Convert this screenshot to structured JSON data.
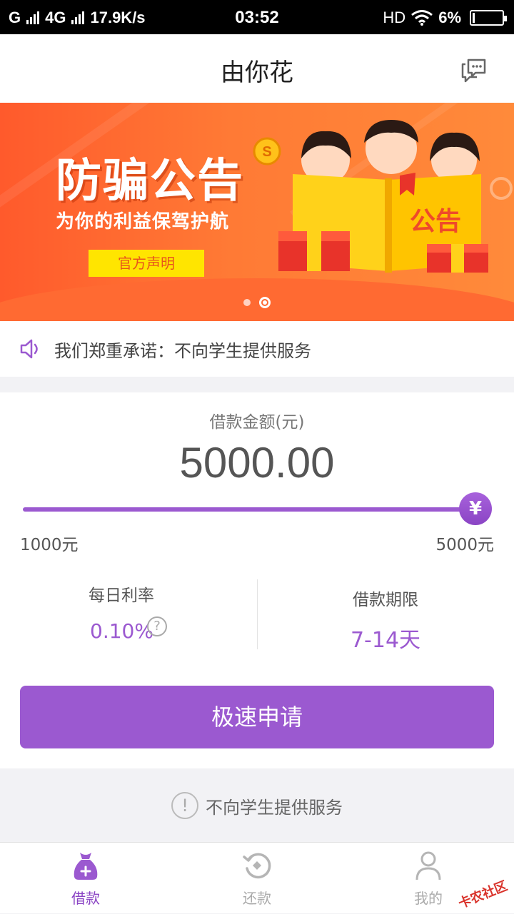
{
  "status_bar": {
    "carrier_left": "G",
    "network": "4G",
    "speed": "17.9K/s",
    "time": "03:52",
    "hd": "HD",
    "battery": "6%",
    "battery_level": 0.06
  },
  "header": {
    "title": "由你花"
  },
  "banner": {
    "title": "防骗公告",
    "subtitle": "为你的利益保驾护航",
    "button_label": "官方声明",
    "book_text": "公告",
    "active_slide": 2,
    "slide_count": 2
  },
  "notice": {
    "text": "我们郑重承诺：不向学生提供服务"
  },
  "loan": {
    "amount_label": "借款金额(元)",
    "amount_value": "5000.00",
    "slider_min_label": "1000元",
    "slider_max_label": "5000元",
    "slider_level": 1.0,
    "thumb_symbol": "¥",
    "rate_label": "每日利率",
    "rate_value": "0.10%",
    "rate_help_symbol": "?",
    "term_label": "借款期限",
    "term_value": "7-14天",
    "apply_label": "极速申请"
  },
  "footer_notice": {
    "icon_symbol": "!",
    "text": "不向学生提供服务"
  },
  "tabs": [
    {
      "label": "借款",
      "icon": "loan-bag-icon",
      "active": true
    },
    {
      "label": "还款",
      "icon": "repay-icon",
      "active": false
    },
    {
      "label": "我的",
      "icon": "profile-icon",
      "active": false
    }
  ],
  "watermark": "卡农社区",
  "colors": {
    "accent": "#9b59d0",
    "banner": "#ff6a32",
    "highlight": "#ffe500"
  }
}
